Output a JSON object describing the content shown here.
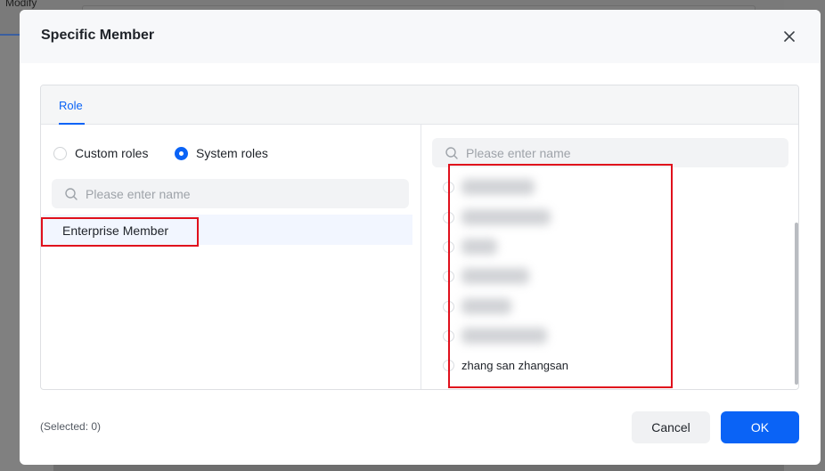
{
  "background": {
    "tab_label": "Modify"
  },
  "modal": {
    "title": "Specific Member",
    "tabs": [
      {
        "label": "Role",
        "active": true
      }
    ],
    "left": {
      "role_type_options": [
        {
          "label": "Custom roles",
          "selected": false
        },
        {
          "label": "System roles",
          "selected": true
        }
      ],
      "search_placeholder": "Please enter name",
      "roles": [
        {
          "label": "Enterprise Member"
        }
      ]
    },
    "right": {
      "search_placeholder": "Please enter name",
      "members": [
        {
          "name": "",
          "redacted": true
        },
        {
          "name": "",
          "redacted": true
        },
        {
          "name": "",
          "redacted": true
        },
        {
          "name": "",
          "redacted": true
        },
        {
          "name": "",
          "redacted": true
        },
        {
          "name": "",
          "redacted": true
        },
        {
          "name": "zhang san zhangsan",
          "redacted": false
        }
      ]
    },
    "footer": {
      "selected_text": "(Selected: 0)",
      "cancel_label": "Cancel",
      "ok_label": "OK"
    }
  },
  "colors": {
    "primary": "#0a63f6",
    "highlight_box": "#e0101c",
    "overlay": "#808080"
  }
}
